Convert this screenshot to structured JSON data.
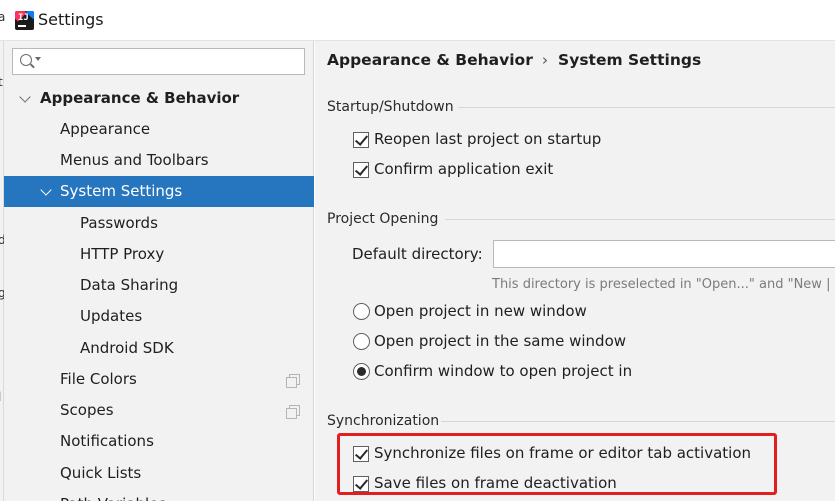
{
  "window": {
    "title": "Settings"
  },
  "left_edge_glyphs": [
    "a",
    "t",
    "d",
    "g",
    "l"
  ],
  "search": {
    "placeholder": ""
  },
  "sidebar": {
    "items": [
      {
        "label": "Appearance & Behavior",
        "expanded": true,
        "bold": true
      },
      {
        "label": "Appearance"
      },
      {
        "label": "Menus and Toolbars"
      },
      {
        "label": "System Settings",
        "expanded": true,
        "selected": true
      },
      {
        "label": "Passwords"
      },
      {
        "label": "HTTP Proxy"
      },
      {
        "label": "Data Sharing"
      },
      {
        "label": "Updates"
      },
      {
        "label": "Android SDK"
      },
      {
        "label": "File Colors",
        "icon": "copy-icon"
      },
      {
        "label": "Scopes",
        "icon": "copy-icon"
      },
      {
        "label": "Notifications"
      },
      {
        "label": "Quick Lists"
      },
      {
        "label": "Path Variables"
      }
    ]
  },
  "breadcrumb": {
    "parent": "Appearance & Behavior",
    "separator": "›",
    "current": "System Settings"
  },
  "sections": {
    "startup": {
      "title": "Startup/Shutdown",
      "options": [
        {
          "label": "Reopen last project on startup",
          "checked": true
        },
        {
          "label": "Confirm application exit",
          "checked": true
        }
      ]
    },
    "project_opening": {
      "title": "Project Opening",
      "default_directory_label": "Default directory:",
      "default_directory_value": "",
      "hint": "This directory is preselected in \"Open...\" and \"New |",
      "options": [
        {
          "label": "Open project in new window",
          "selected": false
        },
        {
          "label": "Open project in the same window",
          "selected": false
        },
        {
          "label": "Confirm window to open project in",
          "selected": true
        }
      ]
    },
    "synchronization": {
      "title": "Synchronization",
      "options": [
        {
          "label": "Synchronize files on frame or editor tab activation",
          "checked": true
        },
        {
          "label": "Save files on frame deactivation",
          "checked": true
        }
      ]
    }
  },
  "colors": {
    "selection": "#2675bf",
    "highlight_box": "#e0201c",
    "panel_bg": "#f2f2f2"
  }
}
